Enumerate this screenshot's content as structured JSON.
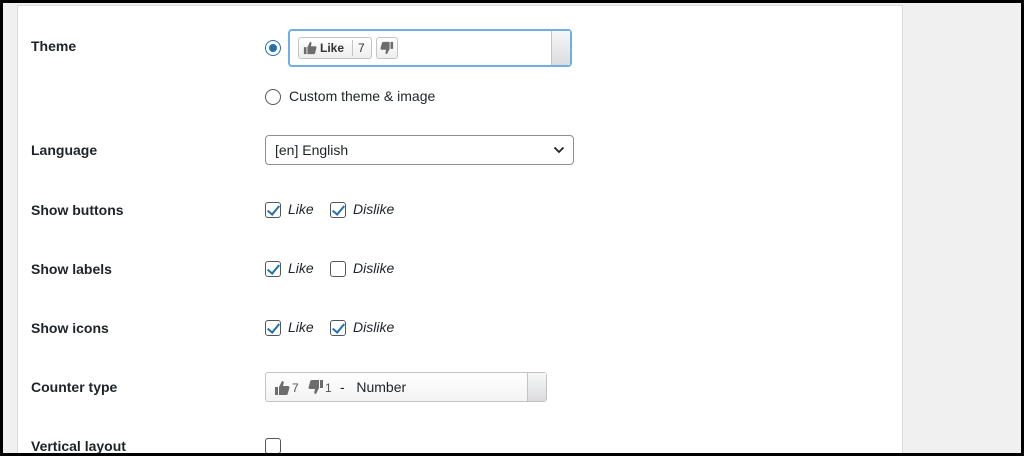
{
  "rows": {
    "theme": {
      "label": "Theme"
    },
    "language": {
      "label": "Language"
    },
    "show_buttons": {
      "label": "Show buttons"
    },
    "show_labels": {
      "label": "Show labels"
    },
    "show_icons": {
      "label": "Show icons"
    },
    "counter_type": {
      "label": "Counter type"
    },
    "vertical_layout": {
      "label": "Vertical layout"
    }
  },
  "theme": {
    "preview_like_label": "Like",
    "preview_like_count": "7",
    "custom_option_label": "Custom theme & image",
    "selected": "preview"
  },
  "language": {
    "selected": "[en] English"
  },
  "show_buttons": {
    "like": "Like",
    "dislike": "Dislike",
    "like_checked": true,
    "dislike_checked": true
  },
  "show_labels": {
    "like": "Like",
    "dislike": "Dislike",
    "like_checked": true,
    "dislike_checked": false
  },
  "show_icons": {
    "like": "Like",
    "dislike": "Dislike",
    "like_checked": true,
    "dislike_checked": true
  },
  "counter_type": {
    "like_count": "7",
    "dislike_count": "1",
    "separator": "-",
    "label": "Number"
  },
  "vertical_layout": {
    "checked": false
  },
  "colors": {
    "accent": "#2271b1",
    "icon_gray": "#6d6d6d"
  },
  "icons": {
    "like": "thumbs-up-icon",
    "dislike": "thumbs-down-icon",
    "dropdown": "chevron-down-icon"
  }
}
